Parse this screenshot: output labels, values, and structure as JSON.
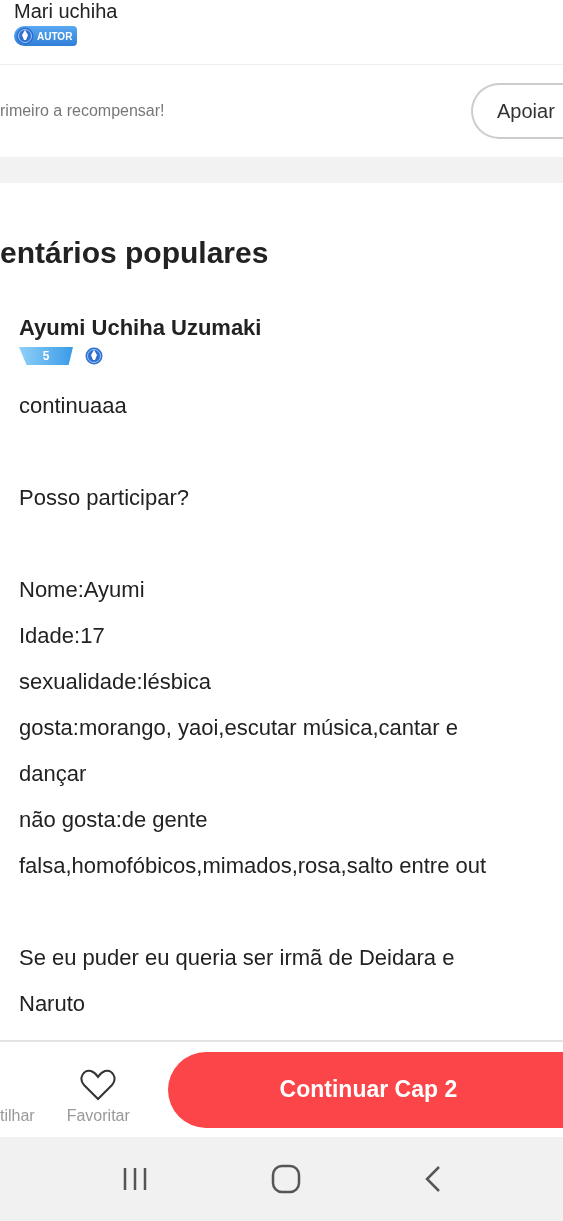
{
  "author": {
    "name": "Mari uchiha",
    "badge": "AUTOR"
  },
  "support": {
    "text": "rimeiro a recompensar!",
    "button": "Apoiar"
  },
  "comments_section": {
    "title": "entários populares",
    "comments": [
      {
        "user": "Ayumi Uchiha Uzumaki",
        "level": "5",
        "paragraphs": [
          [
            "continuaaa"
          ],
          [
            "Posso participar?"
          ],
          [
            "Nome:Ayumi",
            "Idade:17",
            "sexualidade:lésbica",
            "gosta:morango, yaoi,escutar música,cantar e",
            "dançar",
            "não gosta:de gente",
            "falsa,homofóbicos,mimados,rosa,salto entre out"
          ],
          [
            "Se eu puder eu queria ser irmã de Deidara e",
            "Naruto"
          ]
        ]
      }
    ]
  },
  "bottom_bar": {
    "actions": [
      {
        "kind": "text",
        "label": "tilhar"
      },
      {
        "kind": "heart",
        "label": "Favoritar"
      }
    ],
    "continue_button": "Continuar Cap 2"
  },
  "nav_bar": {
    "buttons": [
      {
        "kind": "recent"
      },
      {
        "kind": "home"
      },
      {
        "kind": "back"
      }
    ]
  }
}
